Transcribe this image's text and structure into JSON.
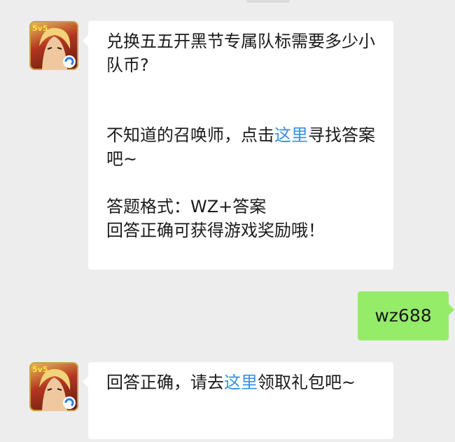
{
  "messages": {
    "m1": {
      "question": "兑换五五开黑节专属队标需要多少小队币?",
      "hint_pre": "不知道的召唤师，点击",
      "hint_link": "这里",
      "hint_post": "寻找答案吧~",
      "format_label": "答题格式：WZ+答案",
      "reward_text": "回答正确可获得游戏奖励哦！"
    },
    "m2": {
      "text": "wz688"
    },
    "m3": {
      "pre": "回答正确，请去",
      "link": "这里",
      "post": "领取礼包吧~"
    }
  },
  "avatar": {
    "badge_text": "5v5",
    "icon": "honor-of-kings-avatar"
  },
  "colors": {
    "background": "#ededed",
    "bubble_in": "#ffffff",
    "bubble_out": "#95ec69",
    "link": "#3b8ee8"
  }
}
